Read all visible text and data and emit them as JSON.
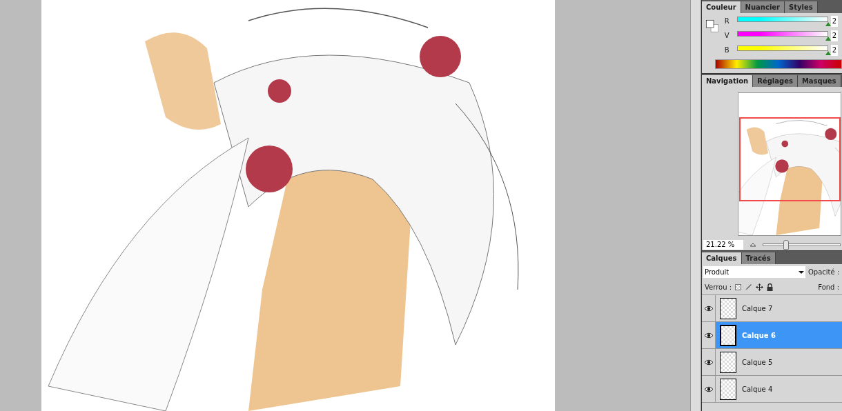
{
  "color_panel": {
    "tabs": [
      {
        "label": "Couleur",
        "selected": true
      },
      {
        "label": "Nuancier",
        "selected": false
      },
      {
        "label": "Styles",
        "selected": false
      }
    ],
    "channels": [
      {
        "name": "R",
        "color": "#00ffff",
        "level": 1,
        "value": "2"
      },
      {
        "name": "V",
        "color": "#ff00ff",
        "level": 1,
        "value": "2"
      },
      {
        "name": "B",
        "color": "#ffff00",
        "level": 1,
        "value": "2"
      }
    ]
  },
  "navigator": {
    "tabs": [
      {
        "label": "Navigation",
        "selected": true
      },
      {
        "label": "Réglages",
        "selected": false
      },
      {
        "label": "Masques",
        "selected": false
      }
    ],
    "zoom": "21.22 %",
    "level": 0.3
  },
  "layers_panel": {
    "tabs": [
      {
        "label": "Calques",
        "selected": true
      },
      {
        "label": "Tracés",
        "selected": false
      }
    ],
    "blend_mode": "Produit",
    "opacity_label": "Opacité :",
    "lock_label": "Verrou :",
    "fill_label": "Fond :",
    "layers": [
      {
        "name": "Calque 7",
        "visible": true,
        "selected": false
      },
      {
        "name": "Calque 6",
        "visible": true,
        "selected": true
      },
      {
        "name": "Calque 5",
        "visible": true,
        "selected": false
      },
      {
        "name": "Calque 4",
        "visible": true,
        "selected": false
      }
    ]
  }
}
